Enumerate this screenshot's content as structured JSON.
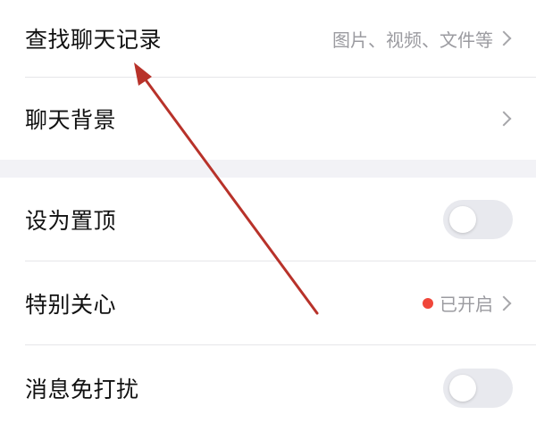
{
  "settings": {
    "search_history": {
      "label": "查找聊天记录",
      "hint": "图片、视频、文件等"
    },
    "chat_background": {
      "label": "聊天背景"
    },
    "pin_to_top": {
      "label": "设为置顶",
      "on": false
    },
    "special_care": {
      "label": "特别关心",
      "status": "已开启",
      "status_color": "#f0463a"
    },
    "do_not_disturb": {
      "label": "消息免打扰",
      "on": false
    }
  },
  "annotation": {
    "color": "#b8322a"
  }
}
